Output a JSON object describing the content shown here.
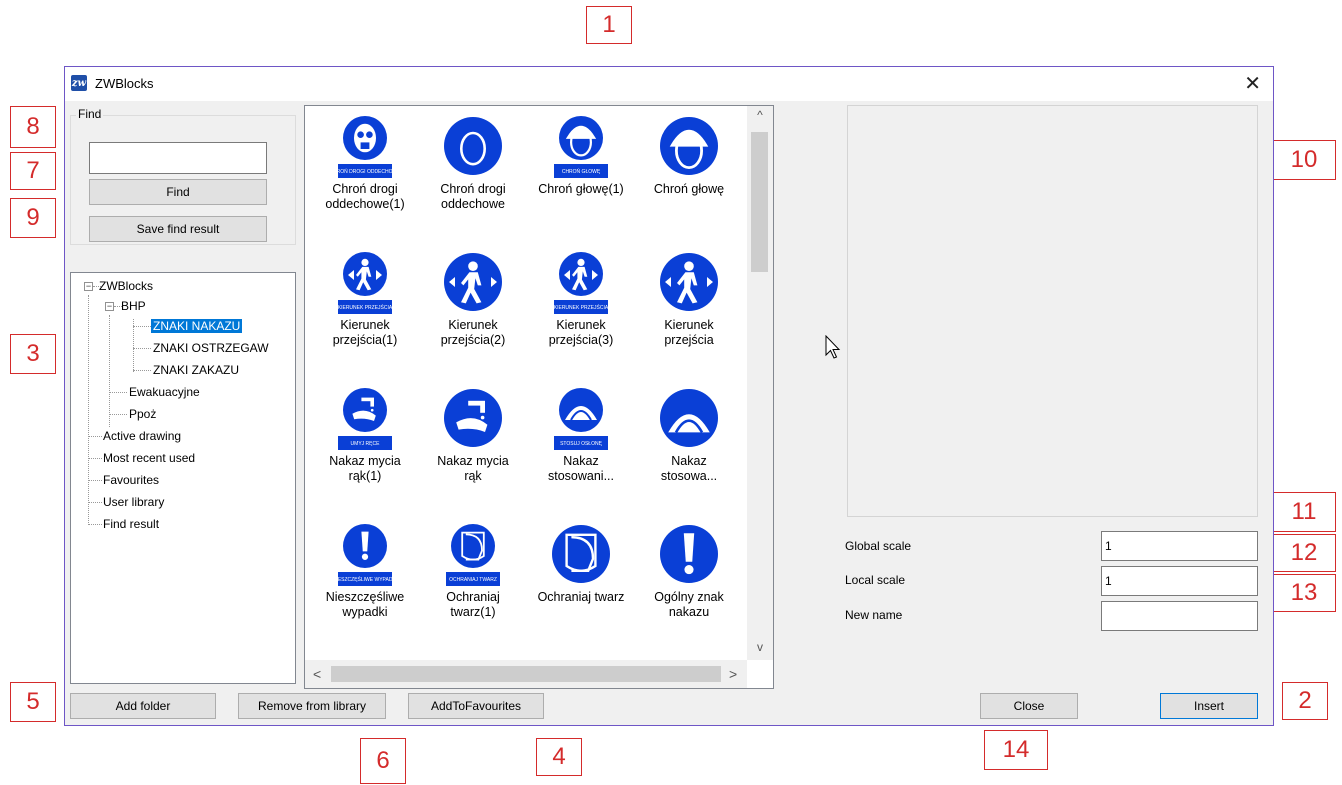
{
  "window": {
    "title": "ZWBlocks",
    "close_symbol": "✕"
  },
  "find": {
    "group_label": "Find",
    "input_value": "",
    "find_button": "Find",
    "save_button": "Save find result"
  },
  "tree": {
    "root": "ZWBlocks",
    "bhp": "BHP",
    "nakazu": "ZNAKI NAKAZU",
    "ostrzegaw": "ZNAKI OSTRZEGAW",
    "zakazu": "ZNAKI ZAKAZU",
    "ewakuacyjne": "Ewakuacyjne",
    "ppoz": "Ppoż",
    "active": "Active drawing",
    "recent": "Most recent used",
    "favourites": "Favourites",
    "user_library": "User library",
    "find_result": "Find result",
    "expander_symbol": "−"
  },
  "blocks": [
    {
      "label": "Chroń drogi\noddechowe(1)",
      "icon": "respirator-sign-icon"
    },
    {
      "label": "Chroń drogi\noddechowe",
      "icon": "respirator-circle-icon"
    },
    {
      "label": "Chroń głowę(1)",
      "icon": "helmet-sign-icon"
    },
    {
      "label": "Chroń głowę",
      "icon": "helmet-circle-icon"
    },
    {
      "label": "Kierunek\nprzejścia(1)",
      "icon": "walk-direction-sign-icon"
    },
    {
      "label": "Kierunek\nprzejścia(2)",
      "icon": "walk-direction-circle-icon"
    },
    {
      "label": "Kierunek\nprzejścia(3)",
      "icon": "walk-direction-sign2-icon"
    },
    {
      "label": "Kierunek\nprzejścia",
      "icon": "walk-direction-circle2-icon"
    },
    {
      "label": "Nakaz mycia\nrąk(1)",
      "icon": "wash-hands-sign-icon"
    },
    {
      "label": "Nakaz mycia\nrąk",
      "icon": "wash-hands-circle-icon"
    },
    {
      "label": "Nakaz\nstosowani...",
      "icon": "guard-sign-icon"
    },
    {
      "label": "Nakaz\nstosowa...",
      "icon": "guard-circle-icon"
    },
    {
      "label": "Nieszczęśliwe\nwypadki",
      "icon": "exclamation-sign-icon"
    },
    {
      "label": "Ochraniaj\ntwarz(1)",
      "icon": "face-shield-sign-icon"
    },
    {
      "label": "Ochraniaj twarz",
      "icon": "face-shield-circle-icon"
    },
    {
      "label": "Ogólny znak\nnakazu",
      "icon": "exclamation-circle-icon"
    }
  ],
  "sign_captions": {
    "respirator": "CHROŃ DROGI ODDECHOWE",
    "helmet": "CHROŃ GŁOWĘ",
    "walk1": "KIERUNEK PRZEJŚCIA",
    "walk2": "KIERUNEK PRZEJŚCIA",
    "wash": "UMYJ RĘCE",
    "guard": "STOSUJ OSŁONĘ",
    "exclaim": "NIESZCZĘŚLIWE WYPADKI",
    "face": "OCHRANIAJ TWARZ"
  },
  "scroll": {
    "up": "^",
    "down": "v",
    "left": "<",
    "right": ">"
  },
  "properties": {
    "global_scale_label": "Global scale",
    "global_scale_value": "1",
    "local_scale_label": "Local scale",
    "local_scale_value": "1",
    "new_name_label": "New name",
    "new_name_value": ""
  },
  "buttons": {
    "add_folder": "Add folder",
    "remove": "Remove from library",
    "add_favourites": "AddToFavourites",
    "close": "Close",
    "insert": "Insert"
  },
  "callouts": [
    "1",
    "2",
    "3",
    "4",
    "5",
    "6",
    "7",
    "8",
    "9",
    "10",
    "11",
    "12",
    "13",
    "14"
  ],
  "colors": {
    "sign_blue": "#0a3fd6",
    "selection": "#0078d7",
    "callout": "#d42b2b"
  }
}
